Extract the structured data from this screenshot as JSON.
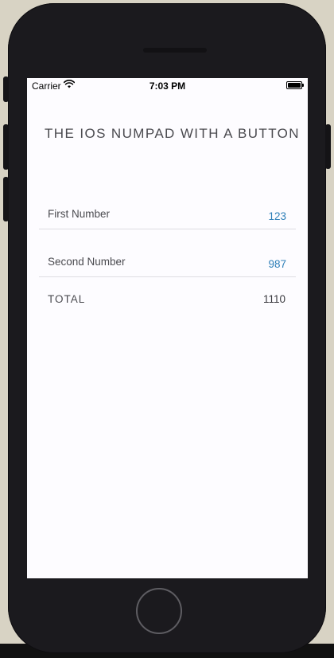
{
  "status_bar": {
    "carrier": "Carrier",
    "time": "7:03 PM",
    "wifi_icon": "wifi-icon",
    "battery_icon": "battery-icon"
  },
  "header": {
    "title": "THE IOS NUMPAD WITH A BUTTON"
  },
  "form": {
    "first": {
      "label": "First Number",
      "value": "123"
    },
    "second": {
      "label": "Second Number",
      "value": "987"
    },
    "total": {
      "label": "TOTAL",
      "value": "1110"
    }
  },
  "colors": {
    "accent": "#2e7fb8",
    "text": "#4a4a4f",
    "screen_bg": "#fdfcff",
    "device": "#1b1a1e"
  }
}
